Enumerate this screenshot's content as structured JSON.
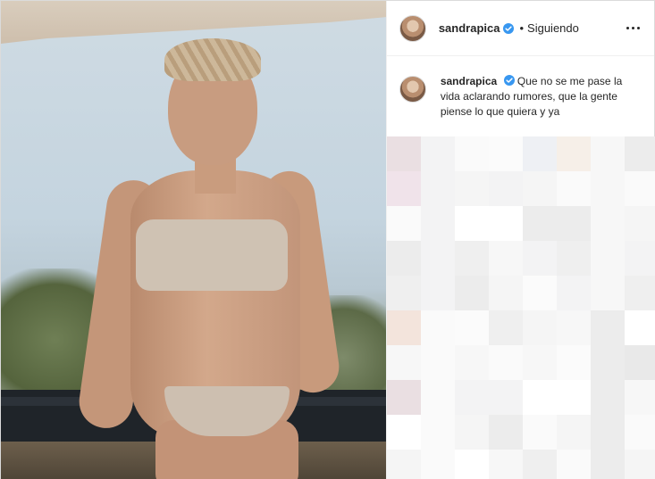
{
  "post": {
    "username": "sandrapica",
    "follow_status": "Siguiendo",
    "separator": "•",
    "caption": "Que no se me pase la vida aclarando rumores, que la gente piense lo que quiera y ya",
    "icons": {
      "verified": "verified-badge-icon",
      "more": "more-options-icon"
    },
    "colors": {
      "verified": "#3897f0",
      "text": "#262626",
      "border": "#dbdbdb"
    }
  }
}
